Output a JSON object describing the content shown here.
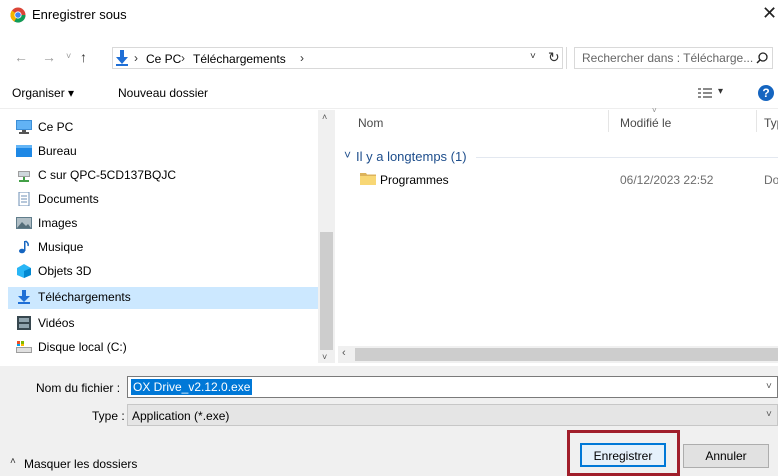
{
  "window": {
    "title": "Enregistrer sous",
    "close_glyph": "✕"
  },
  "address": {
    "root": "Ce PC",
    "current": "Téléchargements",
    "separator": "›"
  },
  "search": {
    "placeholder": "Rechercher dans : Télécharge..."
  },
  "toolbar": {
    "organize_label": "Organiser ▾",
    "new_folder_label": "Nouveau dossier"
  },
  "nav": {
    "items": [
      {
        "label": "Ce PC",
        "icon": "computer-icon"
      },
      {
        "label": "Bureau",
        "icon": "desktop-icon"
      },
      {
        "label": "C sur QPC-5CD137BQJC",
        "icon": "network-drive-icon"
      },
      {
        "label": "Documents",
        "icon": "documents-icon"
      },
      {
        "label": "Images",
        "icon": "images-icon"
      },
      {
        "label": "Musique",
        "icon": "music-icon"
      },
      {
        "label": "Objets 3D",
        "icon": "objects-3d-icon"
      },
      {
        "label": "Téléchargements",
        "icon": "downloads-icon",
        "selected": true
      },
      {
        "label": "Vidéos",
        "icon": "videos-icon"
      },
      {
        "label": "Disque local (C:)",
        "icon": "local-disk-icon"
      }
    ]
  },
  "file_list": {
    "columns": [
      "Nom",
      "Modifié le",
      "Typ"
    ],
    "group_label": "Il y a longtemps (1)",
    "rows": [
      {
        "name": "Programmes",
        "modified": "06/12/2023 22:52",
        "type": "Do"
      }
    ]
  },
  "form": {
    "filename_label": "Nom du fichier :",
    "filename_value": "OX Drive_v2.12.0.exe",
    "type_label": "Type :",
    "type_value": "Application (*.exe)"
  },
  "footer": {
    "hide_folders_label": "Masquer les dossiers",
    "save_label": "Enregistrer",
    "cancel_label": "Annuler"
  },
  "colors": {
    "accent": "#0078d7",
    "selection": "#cce8ff",
    "highlight_box": "#a01e2a"
  }
}
